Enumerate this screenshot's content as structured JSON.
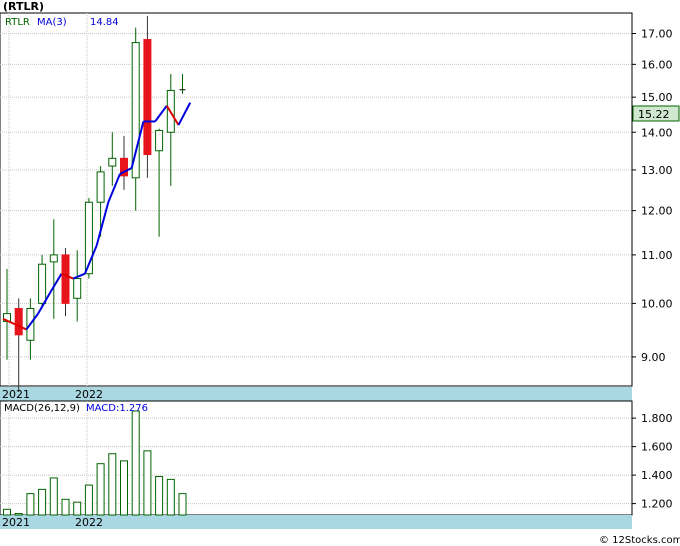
{
  "title": "(RTLR)",
  "legend": {
    "ticker": "RTLR",
    "ma_label": "MA(3)",
    "ma_value": "14.84"
  },
  "last_price_label": "15.22",
  "macd_header": {
    "params": "MACD(26,12,9)",
    "value_label": "MACD:1.276"
  },
  "footer": "© 12Stocks.com",
  "colors": {
    "up_body": "#ffffff",
    "up_outline": "#006400",
    "down_body": "#e8141c",
    "ma_up": "#0000dd",
    "ma_down": "#dd0000",
    "macd_bar": "#006400",
    "date_band": "#aad8e2",
    "price_tag_bg": "#cfe8cf"
  },
  "chart_data": [
    {
      "type": "candlestick",
      "title": "(RTLR)",
      "x_labels": [
        "2021",
        "2022"
      ],
      "y_ticks": [
        "9.00",
        "10.00",
        "11.00",
        "12.00",
        "13.00",
        "14.00",
        "15.00",
        "16.00",
        "17.00"
      ],
      "y_scale": "log",
      "ylim": [
        8.5,
        17.7
      ],
      "grid": true,
      "candles": [
        {
          "o": 9.65,
          "h": 10.7,
          "l": 8.95,
          "c": 9.8
        },
        {
          "o": 9.9,
          "h": 10.1,
          "l": 8.4,
          "c": 9.4
        },
        {
          "o": 9.3,
          "h": 10.1,
          "l": 8.95,
          "c": 9.9
        },
        {
          "o": 10.0,
          "h": 11.0,
          "l": 9.9,
          "c": 10.8
        },
        {
          "o": 10.85,
          "h": 11.8,
          "l": 9.7,
          "c": 11.0
        },
        {
          "o": 11.0,
          "h": 11.15,
          "l": 9.75,
          "c": 10.0
        },
        {
          "o": 10.1,
          "h": 11.1,
          "l": 9.65,
          "c": 10.5
        },
        {
          "o": 10.6,
          "h": 12.3,
          "l": 10.5,
          "c": 12.2
        },
        {
          "o": 12.2,
          "h": 13.1,
          "l": 11.4,
          "c": 12.95
        },
        {
          "o": 13.1,
          "h": 14.0,
          "l": 12.6,
          "c": 13.3
        },
        {
          "o": 13.3,
          "h": 13.9,
          "l": 12.5,
          "c": 12.85
        },
        {
          "o": 12.8,
          "h": 17.2,
          "l": 12.0,
          "c": 16.7
        },
        {
          "o": 16.8,
          "h": 17.6,
          "l": 12.8,
          "c": 13.4
        },
        {
          "o": 13.5,
          "h": 14.1,
          "l": 11.4,
          "c": 14.05
        },
        {
          "o": 14.0,
          "h": 15.7,
          "l": 12.6,
          "c": 15.2
        },
        {
          "o": 15.22,
          "h": 15.7,
          "l": 15.1,
          "c": 15.22
        }
      ],
      "ma3": [
        9.7,
        9.6,
        9.5,
        9.8,
        10.2,
        10.6,
        10.5,
        10.6,
        11.2,
        12.2,
        12.9,
        13.05,
        14.3,
        14.3,
        14.75,
        14.2,
        14.84
      ]
    },
    {
      "type": "bar",
      "title": "MACD(26,12,9)",
      "x_labels": [
        "2021",
        "2022"
      ],
      "y_ticks": [
        "1.200",
        "1.400",
        "1.600",
        "1.800"
      ],
      "ylim": [
        1.12,
        1.92
      ],
      "values": [
        1.16,
        1.13,
        1.27,
        1.3,
        1.38,
        1.23,
        1.21,
        1.33,
        1.48,
        1.55,
        1.5,
        1.85,
        1.57,
        1.39,
        1.37,
        1.27
      ],
      "last_value": 1.276
    }
  ]
}
